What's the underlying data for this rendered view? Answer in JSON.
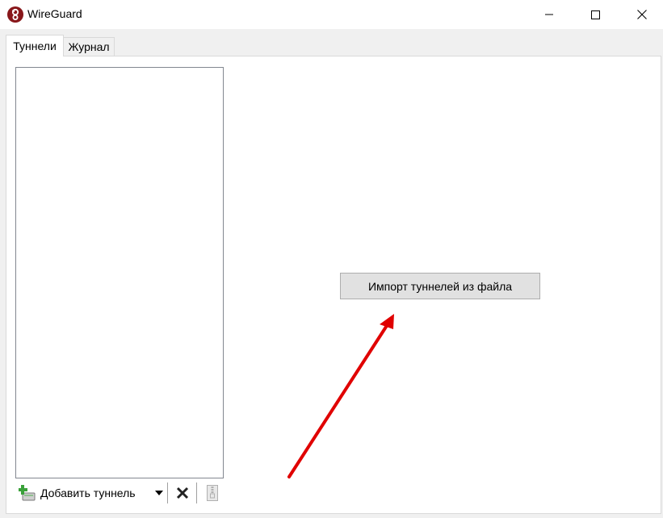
{
  "window": {
    "title": "WireGuard",
    "icon": "wireguard-logo-icon",
    "controls": [
      "minimize-icon",
      "maximize-icon",
      "close-icon"
    ]
  },
  "tabs": [
    {
      "label": "Туннели",
      "active": true
    },
    {
      "label": "Журнал",
      "active": false
    }
  ],
  "tunnels": {
    "items": []
  },
  "toolbar": {
    "add_label": "Добавить туннель",
    "add_icon": "add-tunnel-icon",
    "dropdown_icon": "dropdown-arrow-icon",
    "delete_icon": "delete-icon",
    "export_icon": "export-zip-icon"
  },
  "main": {
    "import_label": "Импорт туннелей из файла"
  },
  "colors": {
    "logo": "#88171a",
    "arrow": "#e00000",
    "add_icon_green": "#3aa13a"
  }
}
